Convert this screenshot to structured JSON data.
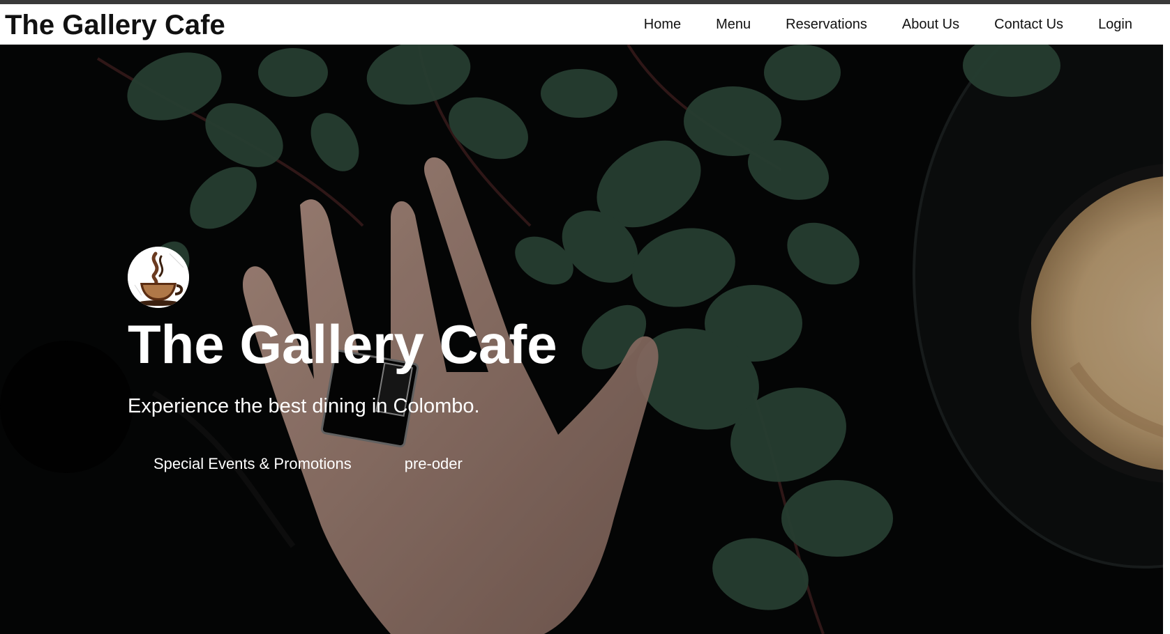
{
  "site": {
    "brand": "The Gallery Cafe"
  },
  "nav": {
    "items": [
      {
        "label": "Home"
      },
      {
        "label": "Menu"
      },
      {
        "label": "Reservations"
      },
      {
        "label": "About Us"
      },
      {
        "label": "Contact Us"
      },
      {
        "label": "Login"
      }
    ]
  },
  "hero": {
    "logo_icon": "coffee-cup-logo",
    "title": "The Gallery Cafe",
    "subtitle": "Experience the best dining in Colombo.",
    "buttons": [
      {
        "label": "Special Events & Promotions"
      },
      {
        "label": "pre-oder"
      }
    ]
  },
  "colors": {
    "nav_bg": "#ffffff",
    "nav_text": "#111111",
    "hero_text": "#ffffff",
    "leaf_green": "#2e4a3c",
    "skin": "#d9b8a6",
    "coffee": "#cdb08a"
  }
}
